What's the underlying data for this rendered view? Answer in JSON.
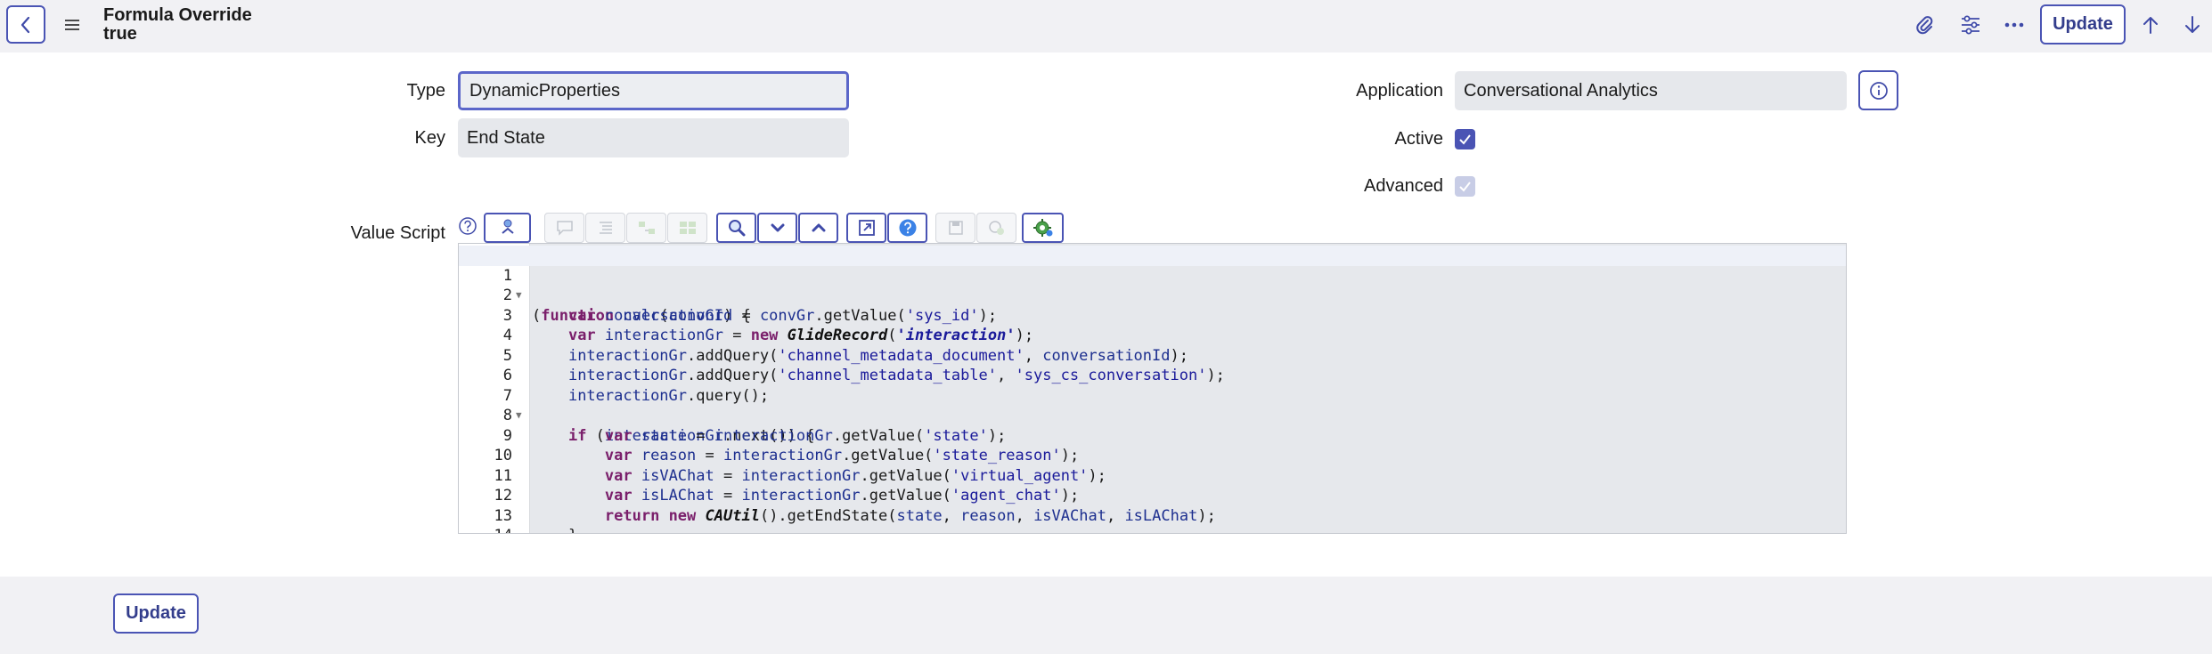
{
  "header": {
    "title_line1": "Formula Override",
    "title_line2": "true",
    "update_label": "Update"
  },
  "form": {
    "type_label": "Type",
    "type_value": "DynamicProperties",
    "key_label": "Key",
    "key_value": "End State",
    "application_label": "Application",
    "application_value": "Conversational Analytics",
    "active_label": "Active",
    "active_checked": true,
    "advanced_label": "Advanced",
    "advanced_checked": true,
    "value_script_label": "Value Script"
  },
  "editor": {
    "line_numbers": [
      "1",
      "2",
      "3",
      "4",
      "5",
      "6",
      "7",
      "8",
      "9",
      "10",
      "11",
      "12",
      "13",
      "14"
    ]
  },
  "footer": {
    "update_label": "Update"
  },
  "colors": {
    "accent": "#4a54b4",
    "field_bg": "#e6e8ec",
    "header_bg": "#f1f1f4"
  },
  "icons": [
    "chevron-left-icon",
    "hamburger-menu-icon",
    "paperclip-icon",
    "sliders-icon",
    "more-horizontal-icon",
    "arrow-up-icon",
    "arrow-down-icon",
    "info-icon",
    "help-circle-icon",
    "check-icon"
  ]
}
